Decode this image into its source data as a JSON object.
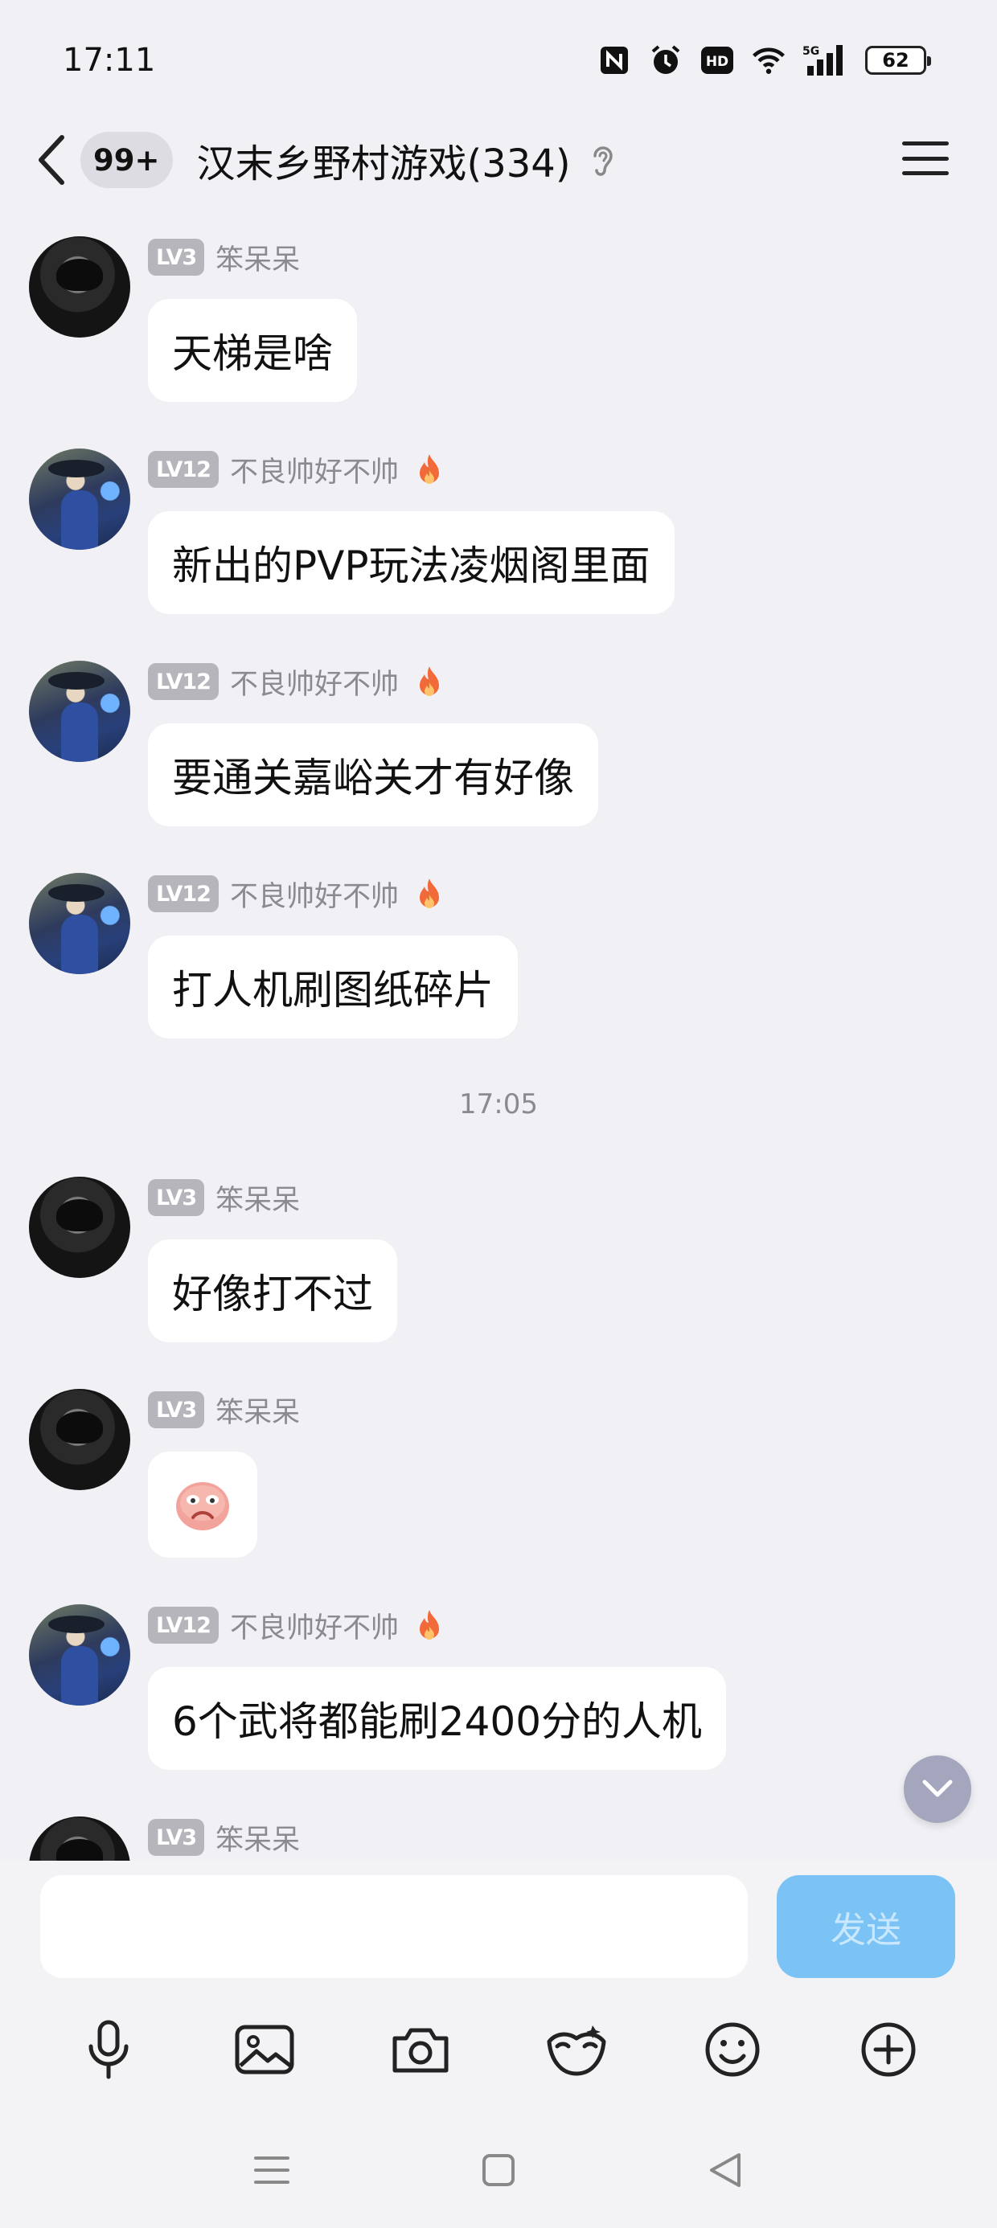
{
  "status_bar": {
    "time": "17:11",
    "battery": "62",
    "icons": [
      "nfc-icon",
      "alarm-icon",
      "hd-icon",
      "wifi-icon",
      "signal-5g-icon",
      "battery-icon"
    ]
  },
  "header": {
    "unread_badge": "99+",
    "title": "汉末乡野村游戏(334)",
    "icons": [
      "back-arrow-icon",
      "ear-icon",
      "menu-icon"
    ]
  },
  "messages": [
    {
      "avatar": "dark",
      "level": "LV3",
      "nickname": "笨呆呆",
      "flame": false,
      "text": "天梯是啥"
    },
    {
      "avatar": "knight",
      "level": "LV12",
      "nickname": "不良帅好不帅",
      "flame": true,
      "text": "新出的PVP玩法凌烟阁里面"
    },
    {
      "avatar": "knight",
      "level": "LV12",
      "nickname": "不良帅好不帅",
      "flame": true,
      "text": "要通关嘉峪关才有好像"
    },
    {
      "avatar": "knight",
      "level": "LV12",
      "nickname": "不良帅好不帅",
      "flame": true,
      "text": "打人机刷图纸碎片"
    },
    {
      "timestamp": "17:05"
    },
    {
      "avatar": "dark",
      "level": "LV3",
      "nickname": "笨呆呆",
      "flame": false,
      "text": "好像打不过"
    },
    {
      "avatar": "dark",
      "level": "LV3",
      "nickname": "笨呆呆",
      "flame": false,
      "sticker": "sad-face-emoji"
    },
    {
      "avatar": "knight",
      "level": "LV12",
      "nickname": "不良帅好不帅",
      "flame": true,
      "text": "6个武将都能刷2400分的人机"
    },
    {
      "avatar": "dark",
      "level": "LV3",
      "nickname": "笨呆呆",
      "flame": false,
      "text": ""
    }
  ],
  "input": {
    "placeholder": "",
    "send_label": "发送"
  },
  "toolbar": [
    "microphone-icon",
    "image-icon",
    "camera-icon",
    "red-packet-mask-icon",
    "emoji-icon",
    "plus-icon"
  ],
  "navbar": [
    "nav-menu-icon",
    "nav-home-icon",
    "nav-back-icon"
  ],
  "colors": {
    "background": "#f0f0f5",
    "send_button": "#7cc3f5",
    "level_badge": "#b5b5bb",
    "flame": "#f26a3a"
  }
}
